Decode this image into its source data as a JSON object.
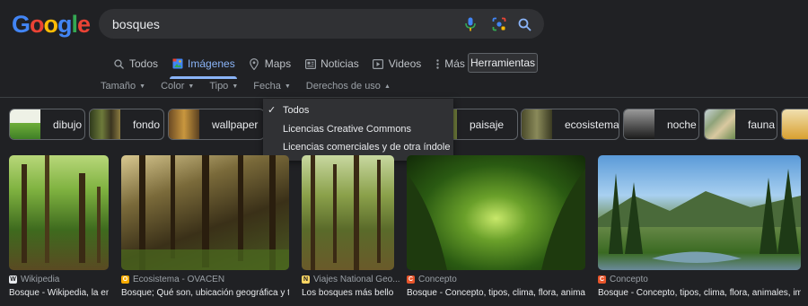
{
  "logo": {
    "letters": [
      "G",
      "o",
      "o",
      "g",
      "l",
      "e"
    ],
    "colors": [
      "#4285f4",
      "#ea4335",
      "#fbbc05",
      "#4285f4",
      "#34a853",
      "#ea4335"
    ]
  },
  "search": {
    "value": "bosques",
    "icons": [
      "mic-icon",
      "camera-lens-icon",
      "search-icon"
    ]
  },
  "tabs": [
    {
      "label": "Todos",
      "icon": "search-icon"
    },
    {
      "label": "Imágenes",
      "icon": "image-icon",
      "active": true
    },
    {
      "label": "Maps",
      "icon": "map-pin-icon"
    },
    {
      "label": "Noticias",
      "icon": "news-icon"
    },
    {
      "label": "Videos",
      "icon": "play-icon"
    },
    {
      "label": "Más",
      "icon": "more-vertical-icon"
    }
  ],
  "tools_label": "Herramientas",
  "filters": [
    "Tamaño",
    "Color",
    "Tipo",
    "Fecha",
    "Derechos de uso"
  ],
  "rights_menu": {
    "items": [
      "Todos",
      "Licencias Creative Commons",
      "Licencias comerciales y de otra índole"
    ],
    "selected": "Todos"
  },
  "chips": [
    "dibujo",
    "fondo",
    "wallpaper",
    "",
    "paisaje",
    "ecosistema",
    "noche",
    "fauna"
  ],
  "results": [
    {
      "source": "Wikipedia",
      "favicon": "W",
      "favicon_color": "#e8eaed",
      "title": "Bosque - Wikipedia, la en..."
    },
    {
      "source": "Ecosistema - OVACEN",
      "favicon": "O",
      "favicon_color": "#f9ab00",
      "title": "Bosque; Qué son, ubicación geográfica y tip..."
    },
    {
      "source": "Viajes National Geo...",
      "favicon": "N",
      "favicon_color": "#fdd663",
      "title": "Los bosques más bello..."
    },
    {
      "source": "Concepto",
      "favicon": "C",
      "favicon_color": "#e8552b",
      "title": "Bosque - Concepto, tipos, clima, flora, animales..."
    },
    {
      "source": "Concepto",
      "favicon": "C",
      "favicon_color": "#e8552b",
      "title": "Bosque - Concepto, tipos, clima, flora, animales, impo..."
    }
  ],
  "colors": {
    "background": "#202124",
    "accent": "#8ab4f8",
    "text": "#bdc1c6"
  }
}
